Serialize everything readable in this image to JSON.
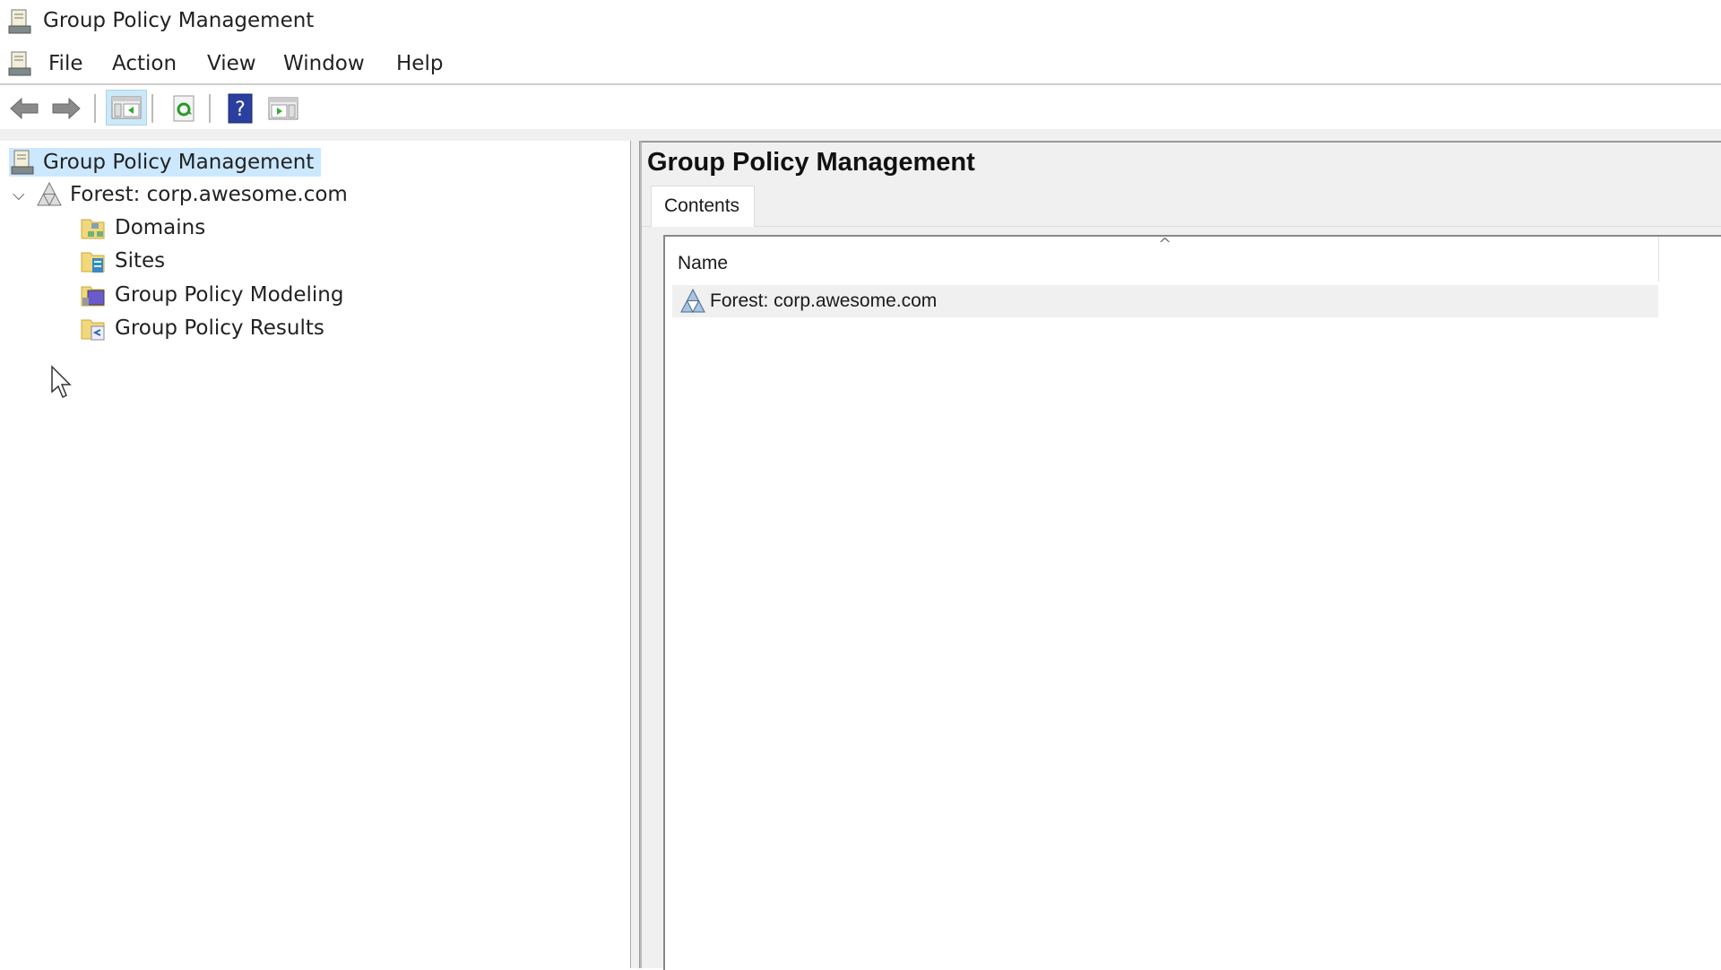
{
  "window": {
    "title": "Group Policy Management"
  },
  "menu": [
    "File",
    "Action",
    "View",
    "Window",
    "Help"
  ],
  "toolbar": {
    "back": "back-icon",
    "forward": "forward-icon",
    "show_hide_tree": "console-tree-icon",
    "refresh": "refresh-icon",
    "help": "help-icon",
    "action_pane": "action-pane-icon"
  },
  "tree": {
    "root": "Group Policy Management",
    "forest": "Forest: corp.awesome.com",
    "children": [
      "Domains",
      "Sites",
      "Group Policy Modeling",
      "Group Policy Results"
    ]
  },
  "details": {
    "title": "Group Policy Management",
    "tab": "Contents",
    "column": "Name",
    "rows": [
      "Forest: corp.awesome.com"
    ]
  },
  "colors": {
    "selection": "#cce8ff",
    "pane_bg": "#f0f0f0",
    "row_highlight": "#f0f0f0"
  }
}
